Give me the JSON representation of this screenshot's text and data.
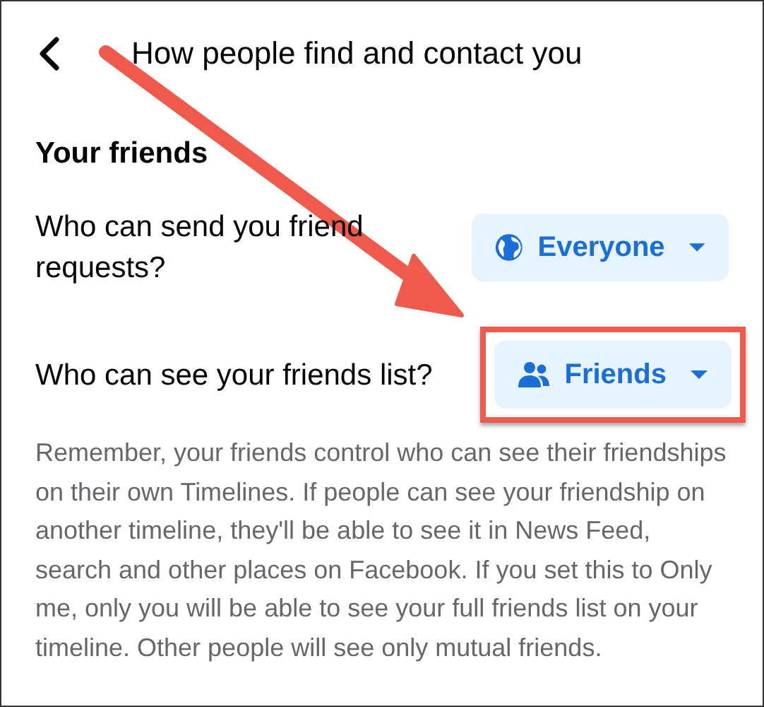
{
  "header": {
    "title": "How people find and contact you"
  },
  "section": {
    "title": "Your friends"
  },
  "settings": [
    {
      "label": "Who can send you friend requests?",
      "value": "Everyone",
      "kind": "globe",
      "highlighted": false
    },
    {
      "label": "Who can see your friends list?",
      "value": "Friends",
      "kind": "people",
      "highlighted": true
    }
  ],
  "note": "Remember, your friends control who can see their friendships on their own Timelines. If people can see your friendship on another timeline, they'll be able to see it in News Feed, search and other places on Facebook. If you set this to Only me, only you will be able to see your full friends list on your timeline. Other people will see only mutual friends."
}
